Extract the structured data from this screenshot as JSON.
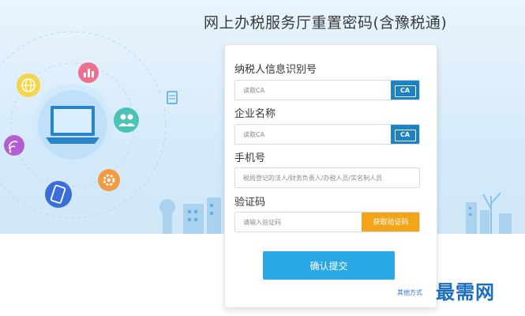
{
  "header": {
    "title": "网上办税服务厅重置密码(含豫税通)"
  },
  "illustration": {
    "icons": [
      "globe-icon",
      "chart-icon",
      "document-icon",
      "users-icon",
      "wifi-icon",
      "laptop-icon",
      "settings-icon",
      "mobile-icon"
    ]
  },
  "form": {
    "taxpayer_id": {
      "label": "纳税人信息识别号",
      "placeholder": "读取CA",
      "button_label": "CA"
    },
    "company_name": {
      "label": "企业名称",
      "placeholder": "读取CA",
      "button_label": "CA"
    },
    "phone": {
      "label": "手机号",
      "placeholder": "税局登记的法人/财务负责人/办税人员/实名制人员"
    },
    "captcha": {
      "label": "验证码",
      "placeholder": "请输入验证码",
      "button_label": "获取验证码"
    },
    "submit_label": "确认提交",
    "other_link": "其他方式"
  },
  "watermark": "最需网",
  "colors": {
    "primary": "#2aa8e6",
    "ca_button": "#1b82c4",
    "code_button": "#f2a518",
    "link": "#2a74c8"
  }
}
